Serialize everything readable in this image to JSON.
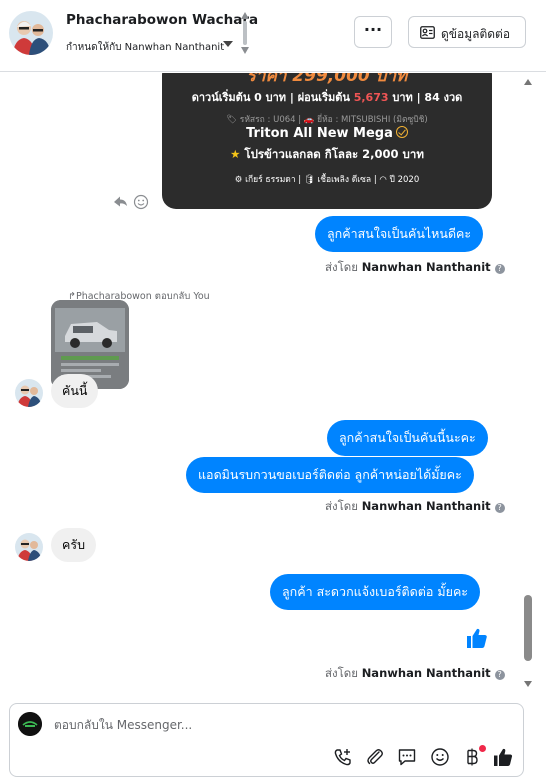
{
  "header": {
    "contact_name": "Phacharabowon Wachara",
    "assign_text": "กำหนดให้กับ Nanwhan Nanthanit",
    "more_label": "···",
    "contact_info_label": "ดูข้อมูลติดต่อ"
  },
  "ad_card": {
    "price": "ราคา 299,000 บาท",
    "terms_a": "ดาวน์เริ่มต้น 0 บาท | ผ่อนเริ่มต้น ",
    "terms_red": "5,673",
    "terms_b": " บาท | 84 งวด",
    "meta": "🏷 รหัสรถ : U064 | 🚗 ยี่ห้อ : MITSUBISHI (มิตซูบิชิ)",
    "model": "Triton All New Mega",
    "promo_star": "★",
    "promo": " โปรข้าวแลกลด กิโลละ 2,000 บาท",
    "specs": "⚙ เกียร์ ธรรมดา   |   🛢 เชื้อเพลิง ดีเซล   |   ◠ ปี 2020"
  },
  "messages": {
    "m1": "ลูกค้าสนใจเป็นคันไหนดีคะ",
    "sent_by_label": "ส่งโดย ",
    "sender": "Nanwhan Nanthanit",
    "info": "?",
    "reply_label": "↱Phacharabowon ตอบกลับ You",
    "m2": "คันนี้",
    "m3": "ลูกค้าสนใจเป็นคันนี้นะคะ",
    "m4": "แอดมินรบกวนขอเบอร์ติดต่อ ลูกค้าหน่อยได้มั้ยคะ",
    "m5": "ครับ",
    "m6": "ลูกค้า สะดวกแจ้งเบอร์ติดต่อ มั้ยคะ"
  },
  "composer": {
    "placeholder": "ตอบกลับใน Messenger..."
  },
  "colors": {
    "accent": "#0084ff",
    "price": "#f08a3e",
    "card_bg": "#2c2c2c"
  },
  "icons": [
    "up-down-arrows-icon",
    "chevron-down-icon",
    "contact-card-icon",
    "reply-icon",
    "emoji-icon",
    "info-icon",
    "like-icon",
    "add-call-icon",
    "attachment-icon",
    "saved-reply-icon",
    "baht-icon"
  ]
}
